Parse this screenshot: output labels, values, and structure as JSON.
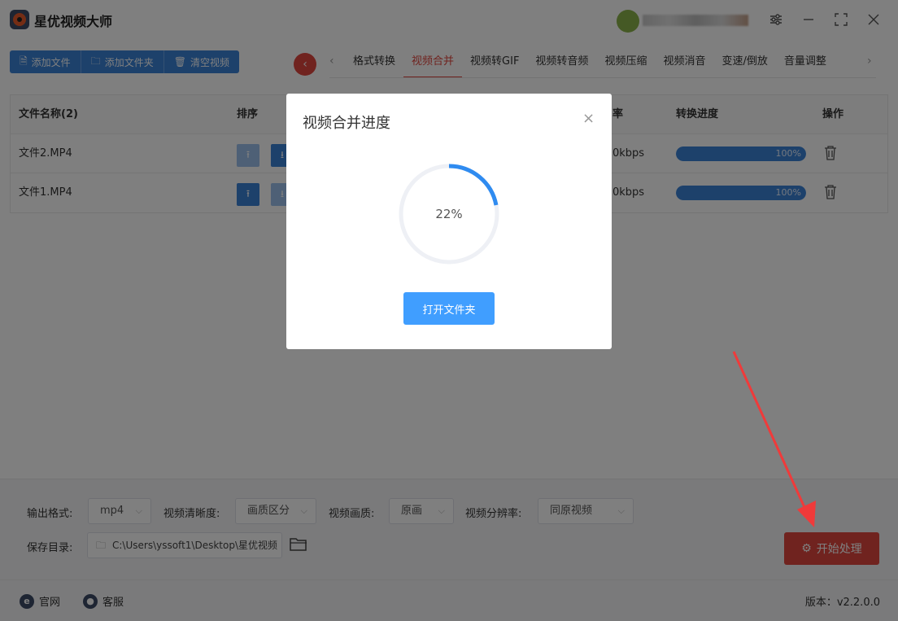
{
  "app": {
    "title": "星优视频大师"
  },
  "toolbar": {
    "add_file": "添加文件",
    "add_folder": "添加文件夹",
    "clear": "清空视频"
  },
  "tabs": [
    {
      "label": "格式转换"
    },
    {
      "label": "视频合并",
      "active": true
    },
    {
      "label": "视频转GIF"
    },
    {
      "label": "视频转音频"
    },
    {
      "label": "视频压缩"
    },
    {
      "label": "视频消音"
    },
    {
      "label": "变速/倒放"
    },
    {
      "label": "音量调整"
    }
  ],
  "table": {
    "headers": {
      "name": "文件名称(2)",
      "sort": "排序",
      "bitrate_partial": "率",
      "progress": "转换进度",
      "action": "操作"
    },
    "rows": [
      {
        "name": "文件2.MP4",
        "bitrate_partial": "0kbps",
        "progress_label": "100%",
        "progress": 1.0
      },
      {
        "name": "文件1.MP4",
        "bitrate_partial": "0kbps",
        "progress_label": "100%",
        "progress": 1.0
      }
    ]
  },
  "settings": {
    "format_label": "输出格式:",
    "format_value": "mp4",
    "clarity_label": "视频清晰度:",
    "clarity_value": "画质区分",
    "quality_label": "视频画质:",
    "quality_value": "原画",
    "resolution_label": "视频分辨率:",
    "resolution_value": "同原视频",
    "save_label": "保存目录:",
    "save_path": "C:\\Users\\yssoft1\\Desktop\\星优视频",
    "start_button": "开始处理"
  },
  "footer": {
    "website": "官网",
    "support": "客服",
    "version": "版本：v2.2.0.0"
  },
  "dialog": {
    "title": "视频合并进度",
    "percent_label": "22%",
    "percent": 0.22,
    "open_folder": "打开文件夹"
  },
  "colors": {
    "accent_red": "#e0463f",
    "primary_blue": "#3b82d6",
    "dialog_blue": "#409eff"
  }
}
